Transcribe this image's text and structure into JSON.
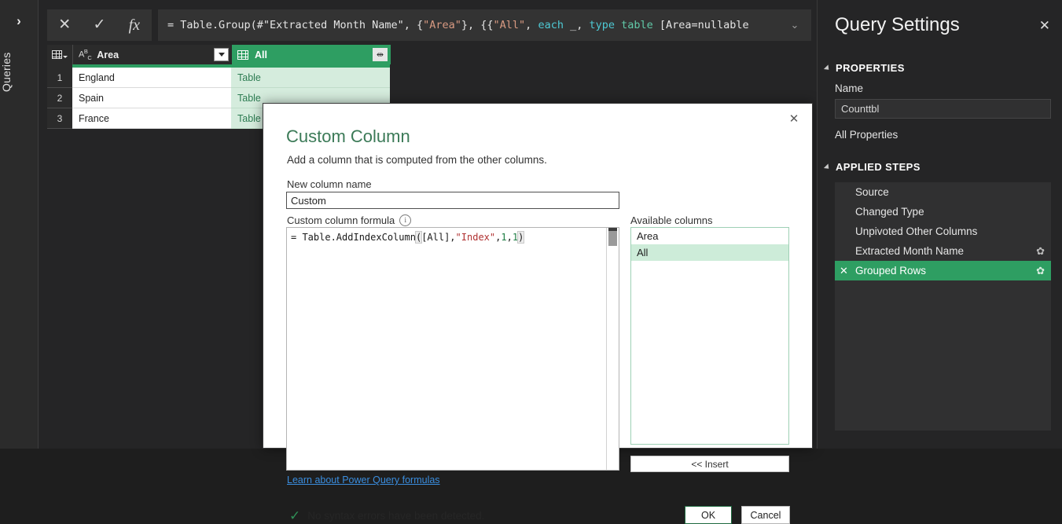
{
  "queries_rail": {
    "label": "Queries",
    "chevron": "›"
  },
  "formula_bar": {
    "cancel_icon": "✕",
    "accept_icon": "✓",
    "fx_icon": "fx",
    "chevron_icon": "⌄",
    "formula_parts": {
      "p1": "= Table.Group(#\"Extracted Month Name\", {",
      "s1": "\"Area\"",
      "p2": "}, {{",
      "s2": "\"All\"",
      "p3": ", ",
      "kw1": "each",
      "p4": " _, ",
      "kw2": "type",
      "p5": " ",
      "tbl": "table",
      "p6": " [Area=nullable"
    },
    "formula_plain": "= Table.Group(#\"Extracted Month Name\", {\"Area\"}, {{\"All\", each _, type table [Area=nullable"
  },
  "grid": {
    "columns": [
      {
        "name": "Area",
        "type_icon": "abc-text-type-icon",
        "control": "filter-dropdown"
      },
      {
        "name": "All",
        "type_icon": "table-type-icon",
        "control": "expand-columns"
      }
    ],
    "rows": [
      {
        "num": "1",
        "area": "England",
        "all": "Table"
      },
      {
        "num": "2",
        "area": "Spain",
        "all": "Table"
      },
      {
        "num": "3",
        "area": "France",
        "all": "Table"
      }
    ],
    "selected_column": "All"
  },
  "dialog": {
    "title": "Custom Column",
    "subtitle": "Add a column that is computed from the other columns.",
    "close_icon": "✕",
    "new_column_name_label": "New column name",
    "new_column_name_value": "Custom",
    "new_column_name_placeholder": "Custom",
    "formula_label": "Custom column formula",
    "info_icon": "i",
    "formula_parts": {
      "p1": "= Table.AddIndexColumn",
      "open": "(",
      "p2": "[All],",
      "s1": "\"Index\"",
      "p3": ",",
      "n1": "1",
      "p4": ",",
      "n2": "1",
      "close": ")"
    },
    "formula_plain": "= Table.AddIndexColumn([All],\"Index\",1,1)",
    "learn_link": "Learn about Power Query formulas",
    "available_columns_label": "Available columns",
    "available_columns": [
      {
        "name": "Area",
        "selected": false
      },
      {
        "name": "All",
        "selected": true
      }
    ],
    "insert_button": "<< Insert",
    "status_icon": "✓",
    "status_text": "No syntax errors have been detected.",
    "ok_button": "OK",
    "cancel_button": "Cancel"
  },
  "query_settings": {
    "title": "Query Settings",
    "close_icon": "✕",
    "properties_section": "PROPERTIES",
    "name_label": "Name",
    "name_value": "Counttbl",
    "all_properties": "All Properties",
    "applied_steps_section": "APPLIED STEPS",
    "steps": [
      {
        "name": "Source",
        "has_delete": false,
        "has_gear": false,
        "active": false
      },
      {
        "name": "Changed Type",
        "has_delete": false,
        "has_gear": false,
        "active": false
      },
      {
        "name": "Unpivoted Other Columns",
        "has_delete": false,
        "has_gear": false,
        "active": false
      },
      {
        "name": "Extracted Month Name",
        "has_delete": false,
        "has_gear": true,
        "active": false
      },
      {
        "name": "Grouped Rows",
        "has_delete": true,
        "has_gear": true,
        "active": true
      }
    ],
    "delete_icon": "✕",
    "gear_icon": "✿"
  },
  "colors": {
    "accent_green": "#2e9e62",
    "cell_green_bg": "#d5ecdd",
    "panel_dark": "#252526",
    "rail_dark": "#2b2b2b",
    "link_blue": "#3a8dde",
    "title_green": "#3b7a57"
  }
}
